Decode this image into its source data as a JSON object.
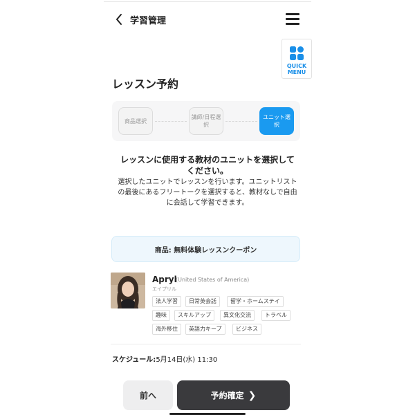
{
  "header": {
    "title": "学習管理"
  },
  "quick_menu": {
    "label": "QUICK MENU",
    "accent": "#1a8fe8"
  },
  "page": {
    "title": "レッスン予約"
  },
  "steps": [
    {
      "label": "商品選択",
      "active": false
    },
    {
      "label": "講師/日程選択",
      "active": false
    },
    {
      "label": "ユニット選択",
      "active": true
    }
  ],
  "instructions": {
    "heading": "レッスンに使用する教材のユニットを選択してください。",
    "body": "選択したユニットでレッスンを行います。ユニットリストの最後にあるフリートークを選択すると、教材なしで自由に会話して学習できます。"
  },
  "product": {
    "text": "商品: 無料体験レッスンクーポン"
  },
  "teacher": {
    "name": "Apryl",
    "country": "(United States of America)",
    "kana": "エイプリル",
    "tags": [
      "法人学習",
      "日常英会話",
      "留学・ホームステイ",
      "趣味",
      "スキルアップ",
      "異文化交流",
      "トラベル",
      "海外移住",
      "英語力キープ",
      "ビジネス"
    ]
  },
  "schedule": {
    "label": "スケジュール:",
    "value": "5月14日(水) 11:30"
  },
  "buttons": {
    "prev": "前へ",
    "confirm": "予約確定",
    "confirm_icon": "chevron-right-icon"
  },
  "colors": {
    "active_step": "#1a9af0",
    "confirm_bg": "#3a3a3d",
    "product_bg": "#eef7fd"
  }
}
